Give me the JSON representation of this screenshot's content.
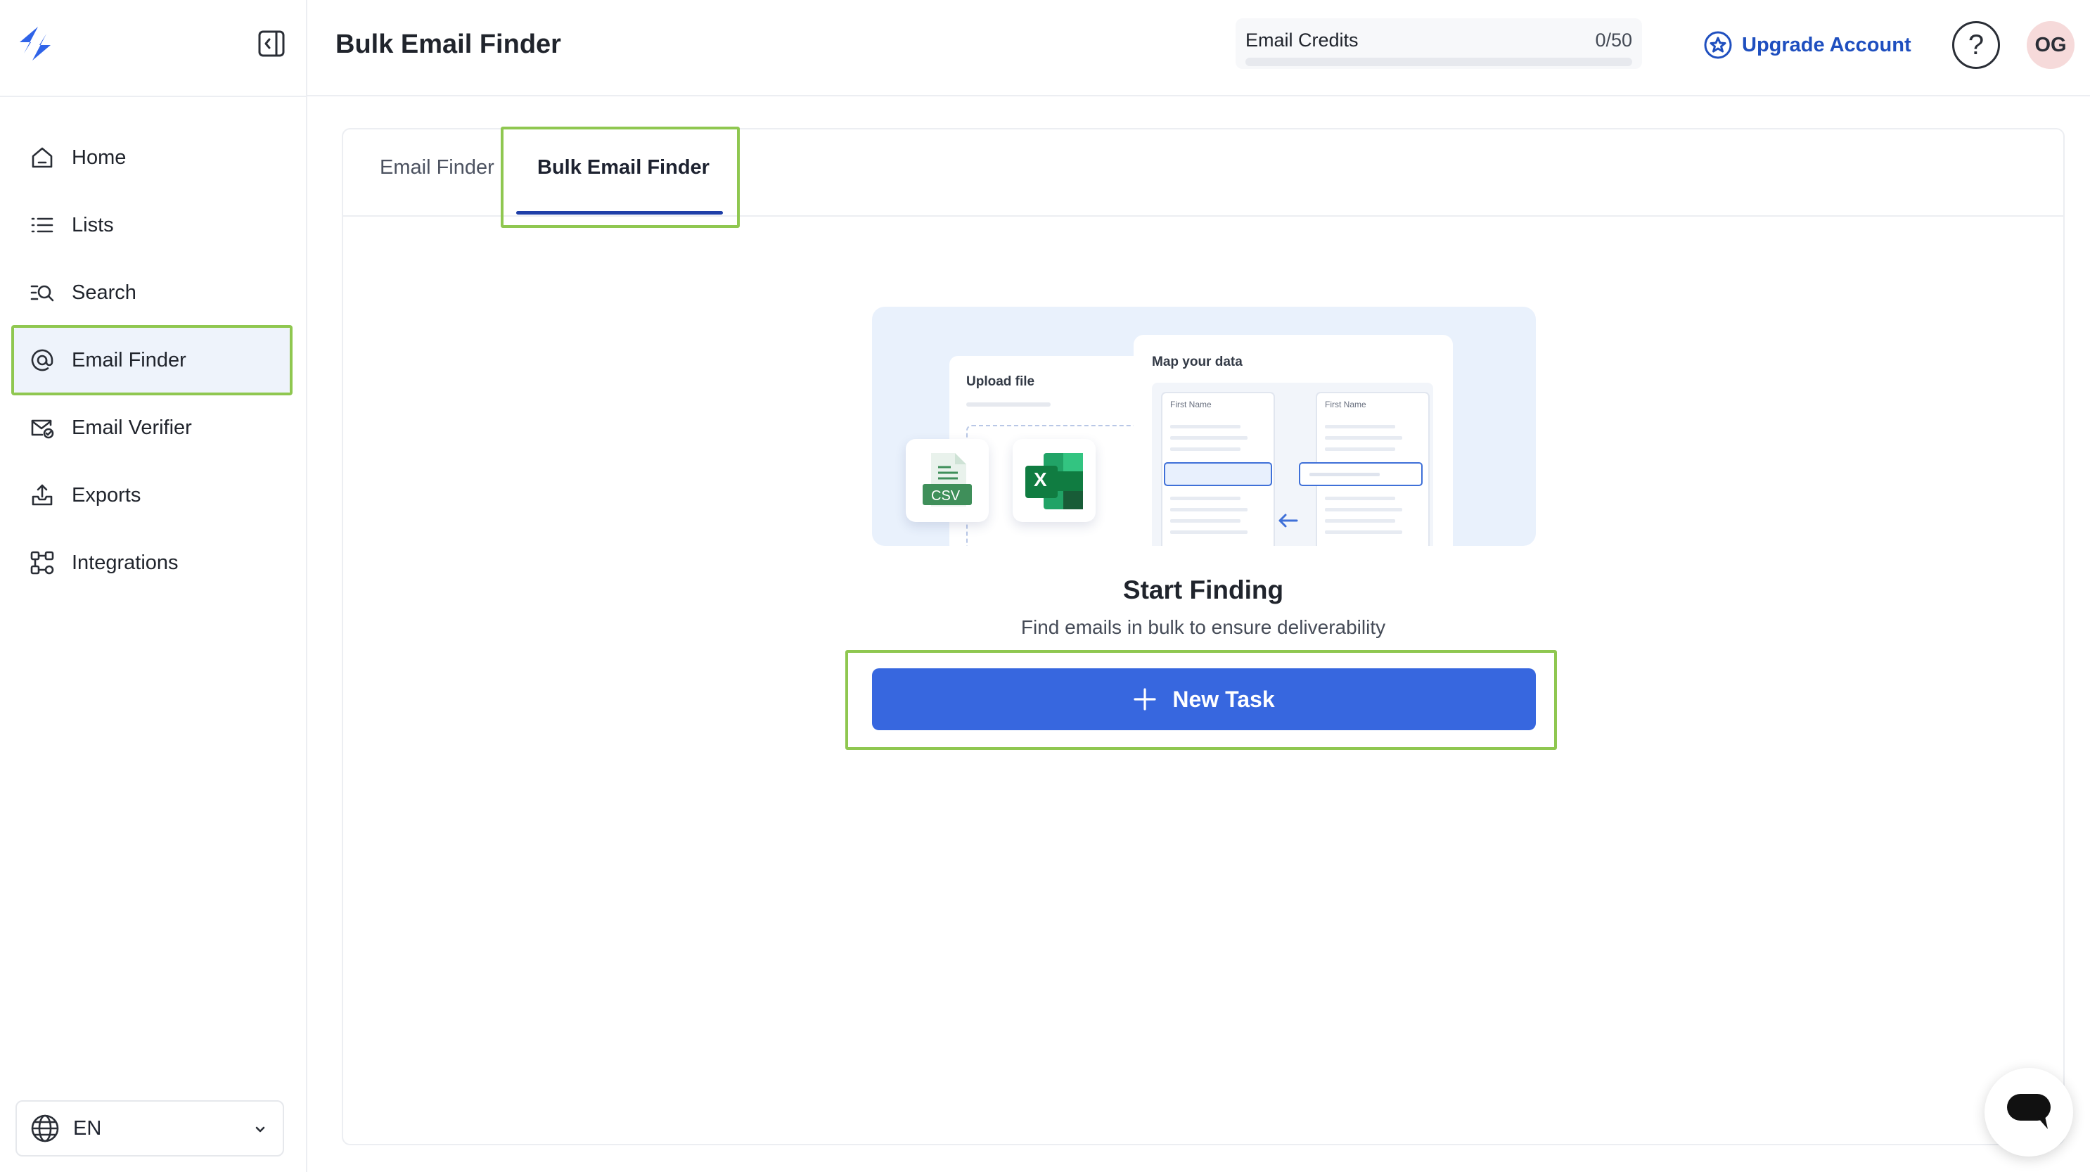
{
  "sidebar": {
    "logo": "brand-logo-icon",
    "items": [
      {
        "label": "Home",
        "icon": "home-icon"
      },
      {
        "label": "Lists",
        "icon": "list-icon"
      },
      {
        "label": "Search",
        "icon": "search-list-icon"
      },
      {
        "label": "Email Finder",
        "icon": "at-sign-icon",
        "active": true
      },
      {
        "label": "Email Verifier",
        "icon": "mail-check-icon"
      },
      {
        "label": "Exports",
        "icon": "upload-tray-icon"
      },
      {
        "label": "Integrations",
        "icon": "integrations-icon"
      }
    ],
    "language": {
      "value": "EN",
      "icon": "globe-icon"
    }
  },
  "header": {
    "title": "Bulk Email Finder",
    "credits": {
      "label": "Email Credits",
      "value": "0/50",
      "fraction": 0
    },
    "upgrade_label": "Upgrade Account",
    "help_label": "?",
    "avatar_initials": "OG"
  },
  "tabs": [
    {
      "label": "Email Finder",
      "active": false
    },
    {
      "label": "Bulk Email Finder",
      "active": true
    }
  ],
  "illustration": {
    "upload_title": "Upload file",
    "map_title": "Map your data",
    "column_label_1": "First Name",
    "column_label_2": "First Name",
    "csv_label": "CSV",
    "excel_label": "X"
  },
  "empty_state": {
    "title": "Start Finding",
    "subtitle": "Find emails in bulk to ensure deliverability",
    "button_label": "New Task"
  },
  "colors": {
    "accent": "#3767df",
    "brand": "#1f4fbf",
    "highlight": "#8fc750"
  }
}
